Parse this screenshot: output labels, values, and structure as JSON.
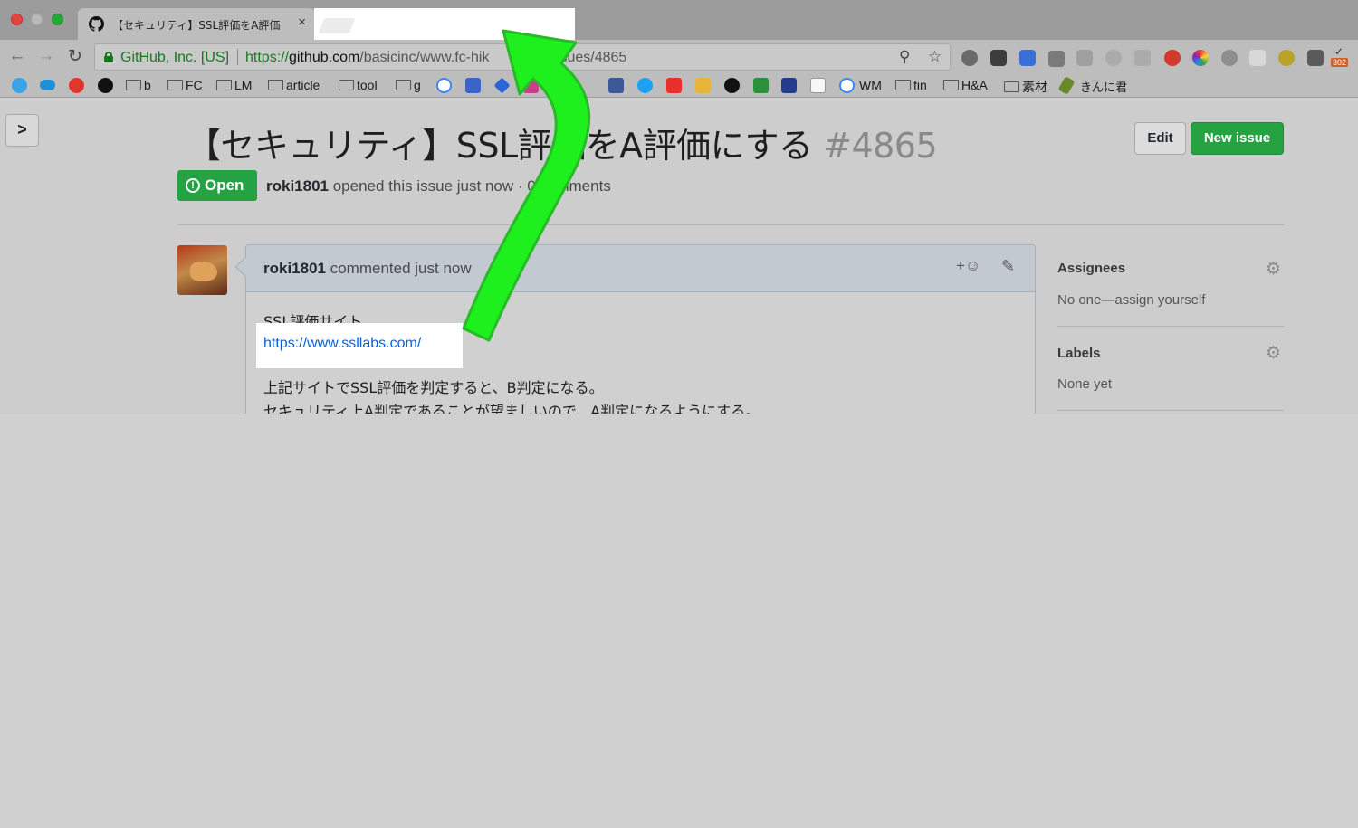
{
  "browser": {
    "tab_title": "【セキュリティ】SSL評価をA評価",
    "tab_close": "×",
    "org_label": "GitHub, Inc. [US]",
    "url_scheme": "https://",
    "url_host": "github.com",
    "url_path_a": "/basicinc/www.fc-hik",
    "url_path_b": "/issues/4865",
    "back_icon": "←",
    "forward_icon": "→",
    "reload_icon": "↻",
    "zoom_icon": "⚲",
    "star_icon": "☆",
    "extension_badge": "302"
  },
  "bookmarks": [
    {
      "label": "b"
    },
    {
      "label": "FC"
    },
    {
      "label": "LM"
    },
    {
      "label": "article"
    },
    {
      "label": "tool"
    },
    {
      "label": "g"
    },
    {
      "label": "WM"
    },
    {
      "label": "fin"
    },
    {
      "label": "H&A"
    },
    {
      "label": "素材"
    },
    {
      "label": "きんに君"
    }
  ],
  "issue": {
    "sidebar_toggle": ">",
    "title": "【セキュリティ】SSL評価をA評価にする",
    "number": "#4865",
    "edit_label": "Edit",
    "new_issue_label": "New issue",
    "state": "Open",
    "state_icon": "!",
    "author": "roki1801",
    "meta_text": " opened this issue just now · 0 comments"
  },
  "comment": {
    "author": "roki1801",
    "time_text": " commented just now",
    "reaction_icon": "+☺",
    "edit_icon": "✎",
    "line1": "SSL評価サイト",
    "link": "https://www.ssllabs.com/",
    "line2": "上記サイトでSSL評価を判定すると、B判定になる。",
    "line3": "セキュリティ上A判定であることが望ましいので、A判定になるようにする。"
  },
  "sidebar": {
    "assignees_label": "Assignees",
    "assignees_value": "No one—assign yourself",
    "labels_label": "Labels",
    "labels_value": "None yet",
    "gear_icon": "⚙"
  },
  "colors": {
    "annotation_arrow": "#1ef01e",
    "open_badge": "#25a244",
    "new_issue_button": "#27a243",
    "link": "#0f5fd4"
  }
}
